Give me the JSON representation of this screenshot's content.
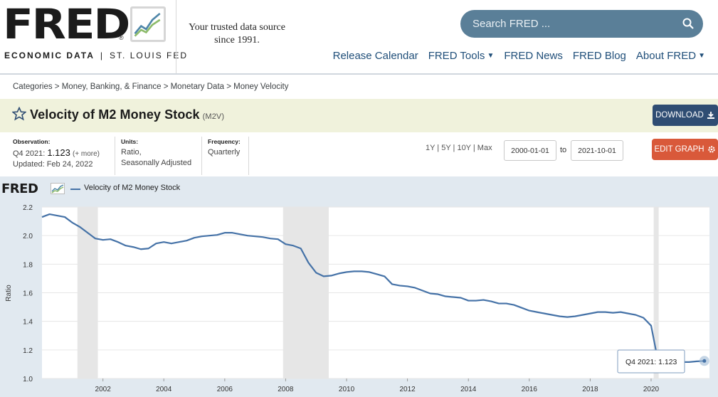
{
  "header": {
    "logo_text": "FRED",
    "logo_reg": "®",
    "econ_label": "ECONOMIC DATA",
    "econ_sep": "|",
    "stl_label": "ST. LOUIS FED",
    "tagline": "Your trusted data source since 1991.",
    "search_placeholder": "Search FRED ...",
    "nav": [
      {
        "label": "Release Calendar"
      },
      {
        "label": "FRED Tools",
        "chevron": true
      },
      {
        "label": "FRED News"
      },
      {
        "label": "FRED Blog"
      },
      {
        "label": "About FRED",
        "chevron": true
      }
    ]
  },
  "breadcrumb": "Categories > Money, Banking, & Finance > Monetary Data > Money Velocity",
  "series": {
    "title": "Velocity of M2 Money Stock",
    "code": "(M2V)",
    "download_label": "DOWNLOAD",
    "edit_label": "EDIT GRAPH"
  },
  "info": {
    "observation_label": "Observation:",
    "observation_period": "Q4 2021:",
    "observation_value": "1.123",
    "observation_more": "(+ more)",
    "updated": "Updated: Feb 24, 2022",
    "units_label": "Units:",
    "units_line1": "Ratio,",
    "units_line2": "Seasonally Adjusted",
    "frequency_label": "Frequency:",
    "frequency_value": "Quarterly",
    "ranges": "1Y | 5Y | 10Y | Max",
    "start_date": "2000-01-01",
    "to_label": "to",
    "end_date": "2021-10-01"
  },
  "chart_legend": "Velocity of M2 Money Stock",
  "tooltip": {
    "label": "Q4 2021:",
    "value": "1.123"
  },
  "colors": {
    "line": "#4572a7",
    "recession": "#e6e6e6",
    "accent_orange": "#d9593a",
    "navy": "#2f4d73"
  },
  "chart_data": {
    "type": "line",
    "title": "Velocity of M2 Money Stock",
    "ylabel": "Ratio",
    "xlabel": "",
    "ylim": [
      1.0,
      2.2
    ],
    "yticks": [
      "1.0",
      "1.2",
      "1.4",
      "1.6",
      "1.8",
      "2.0",
      "2.2"
    ],
    "xticks": [
      "2002",
      "2004",
      "2006",
      "2008",
      "2010",
      "2012",
      "2014",
      "2016",
      "2018",
      "2020"
    ],
    "grid": true,
    "recessions": [
      [
        "2001-03-01",
        "2001-11-01"
      ],
      [
        "2007-12-01",
        "2009-06-01"
      ],
      [
        "2020-02-01",
        "2020-04-01"
      ]
    ],
    "series": [
      {
        "name": "Velocity of M2 Money Stock",
        "x": [
          "2000-01-01",
          "2000-04-01",
          "2000-07-01",
          "2000-10-01",
          "2001-01-01",
          "2001-04-01",
          "2001-07-01",
          "2001-10-01",
          "2002-01-01",
          "2002-04-01",
          "2002-07-01",
          "2002-10-01",
          "2003-01-01",
          "2003-04-01",
          "2003-07-01",
          "2003-10-01",
          "2004-01-01",
          "2004-04-01",
          "2004-07-01",
          "2004-10-01",
          "2005-01-01",
          "2005-04-01",
          "2005-07-01",
          "2005-10-01",
          "2006-01-01",
          "2006-04-01",
          "2006-07-01",
          "2006-10-01",
          "2007-01-01",
          "2007-04-01",
          "2007-07-01",
          "2007-10-01",
          "2008-01-01",
          "2008-04-01",
          "2008-07-01",
          "2008-10-01",
          "2009-01-01",
          "2009-04-01",
          "2009-07-01",
          "2009-10-01",
          "2010-01-01",
          "2010-04-01",
          "2010-07-01",
          "2010-10-01",
          "2011-01-01",
          "2011-04-01",
          "2011-07-01",
          "2011-10-01",
          "2012-01-01",
          "2012-04-01",
          "2012-07-01",
          "2012-10-01",
          "2013-01-01",
          "2013-04-01",
          "2013-07-01",
          "2013-10-01",
          "2014-01-01",
          "2014-04-01",
          "2014-07-01",
          "2014-10-01",
          "2015-01-01",
          "2015-04-01",
          "2015-07-01",
          "2015-10-01",
          "2016-01-01",
          "2016-04-01",
          "2016-07-01",
          "2016-10-01",
          "2017-01-01",
          "2017-04-01",
          "2017-07-01",
          "2017-10-01",
          "2018-01-01",
          "2018-04-01",
          "2018-07-01",
          "2018-10-01",
          "2019-01-01",
          "2019-04-01",
          "2019-07-01",
          "2019-10-01",
          "2020-01-01",
          "2020-04-01",
          "2020-07-01",
          "2020-10-01",
          "2021-01-01",
          "2021-04-01",
          "2021-07-01",
          "2021-10-01"
        ],
        "values": [
          2.13,
          2.15,
          2.14,
          2.13,
          2.09,
          2.06,
          2.02,
          1.98,
          1.97,
          1.975,
          1.955,
          1.93,
          1.92,
          1.905,
          1.91,
          1.945,
          1.955,
          1.945,
          1.955,
          1.965,
          1.985,
          1.995,
          2.0,
          2.005,
          2.02,
          2.02,
          2.01,
          2.0,
          1.995,
          1.99,
          1.98,
          1.975,
          1.94,
          1.93,
          1.91,
          1.81,
          1.74,
          1.715,
          1.72,
          1.735,
          1.745,
          1.75,
          1.75,
          1.745,
          1.73,
          1.715,
          1.66,
          1.65,
          1.645,
          1.635,
          1.615,
          1.595,
          1.59,
          1.575,
          1.57,
          1.565,
          1.545,
          1.545,
          1.55,
          1.54,
          1.525,
          1.525,
          1.515,
          1.495,
          1.475,
          1.465,
          1.455,
          1.445,
          1.435,
          1.43,
          1.435,
          1.445,
          1.455,
          1.465,
          1.465,
          1.46,
          1.465,
          1.455,
          1.445,
          1.425,
          1.37,
          1.1,
          1.115,
          1.12,
          1.115,
          1.115,
          1.12,
          1.123
        ]
      }
    ]
  }
}
